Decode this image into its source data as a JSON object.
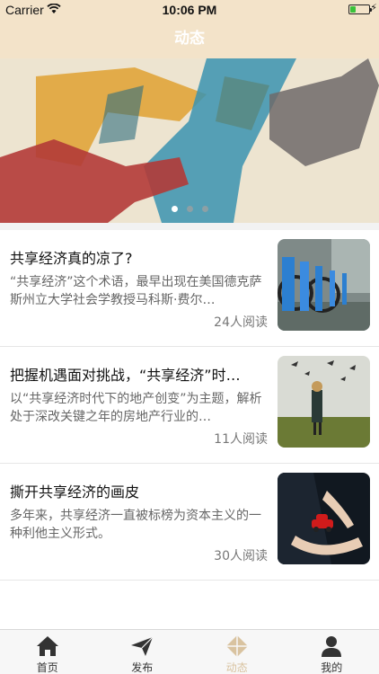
{
  "status_bar": {
    "carrier": "Carrier",
    "time": "10:06 PM"
  },
  "nav": {
    "title": "动态"
  },
  "banner": {
    "slide_count": 3,
    "active_index": 0
  },
  "articles": [
    {
      "title": "共享经济真的凉了?",
      "summary": "“共享经济”这个术语，最早出现在美国德克萨斯州立大学社会学教授马科斯·费尔…",
      "reads": "24人阅读",
      "thumbnail": "bike-share-photo"
    },
    {
      "title": "把握机遇面对挑战，“共享经济”时…",
      "summary": "以“共享经济时代下的地产创变”为主题，解析处于深改关键之年的房地产行业的…",
      "reads": "11人阅读",
      "thumbnail": "woman-umbrellas-photo"
    },
    {
      "title": "撕开共享经济的画皮",
      "summary": "多年来，共享经济一直被标榜为资本主义的一种利他主义形式。",
      "reads": "30人阅读",
      "thumbnail": "hands-car-photo"
    }
  ],
  "tabs": [
    {
      "label": "首页",
      "icon": "home-icon",
      "active": false
    },
    {
      "label": "发布",
      "icon": "paper-plane-icon",
      "active": false
    },
    {
      "label": "动态",
      "icon": "diamond-icon",
      "active": true
    },
    {
      "label": "我的",
      "icon": "person-icon",
      "active": false
    }
  ],
  "colors": {
    "nav_bg": "#f3e3c9",
    "active_tab": "#d9c3a0",
    "battery": "#39c23a"
  }
}
